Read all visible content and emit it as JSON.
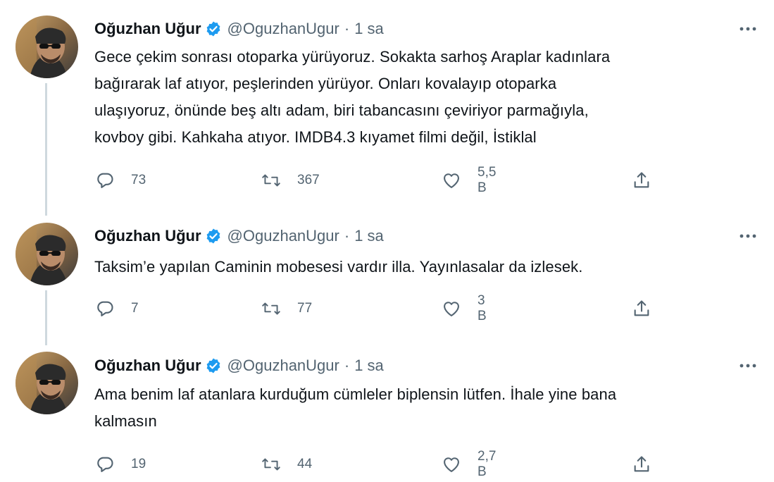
{
  "colors": {
    "verified": "#1d9bf0",
    "secondary_text": "#536471",
    "primary_text": "#0f1419",
    "thread_line": "#cfd9de"
  },
  "tweets": [
    {
      "author_name": "Oğuzhan Uğur",
      "handle": "@OguzhanUgur",
      "separator": "·",
      "time": "1 sa",
      "text_lines": [
        "Gece çekim sonrası otoparka yürüyoruz. Sokakta sarhoş Araplar kadınlara",
        "bağırarak laf atıyor, peşlerinden yürüyor. Onları kovalayıp otoparka",
        "ulaşıyoruz, önünde beş altı adam, biri tabancasını çeviriyor parmağıyla,",
        "kovboy gibi. Kahkaha atıyor. IMDB4.3 kıyamet filmi değil, İstiklal"
      ],
      "replies": "73",
      "retweets": "367",
      "likes": "5,5 B",
      "icons": [
        "reply-icon",
        "retweet-icon",
        "like-icon",
        "share-icon",
        "more-icon",
        "verified-badge-icon"
      ]
    },
    {
      "author_name": "Oğuzhan Uğur",
      "handle": "@OguzhanUgur",
      "separator": "·",
      "time": "1 sa",
      "text_lines": [
        "Taksim’e yapılan Caminin mobesesi vardır illa. Yayınlasalar da izlesek."
      ],
      "replies": "7",
      "retweets": "77",
      "likes": "3 B",
      "icons": [
        "reply-icon",
        "retweet-icon",
        "like-icon",
        "share-icon",
        "more-icon",
        "verified-badge-icon"
      ]
    },
    {
      "author_name": "Oğuzhan Uğur",
      "handle": "@OguzhanUgur",
      "separator": "·",
      "time": "1 sa",
      "text_lines": [
        "Ama benim laf atanlara kurduğum cümleler biplensin lütfen. İhale yine bana",
        "kalmasın"
      ],
      "replies": "19",
      "retweets": "44",
      "likes": "2,7 B",
      "icons": [
        "reply-icon",
        "retweet-icon",
        "like-icon",
        "share-icon",
        "more-icon",
        "verified-badge-icon"
      ]
    }
  ]
}
